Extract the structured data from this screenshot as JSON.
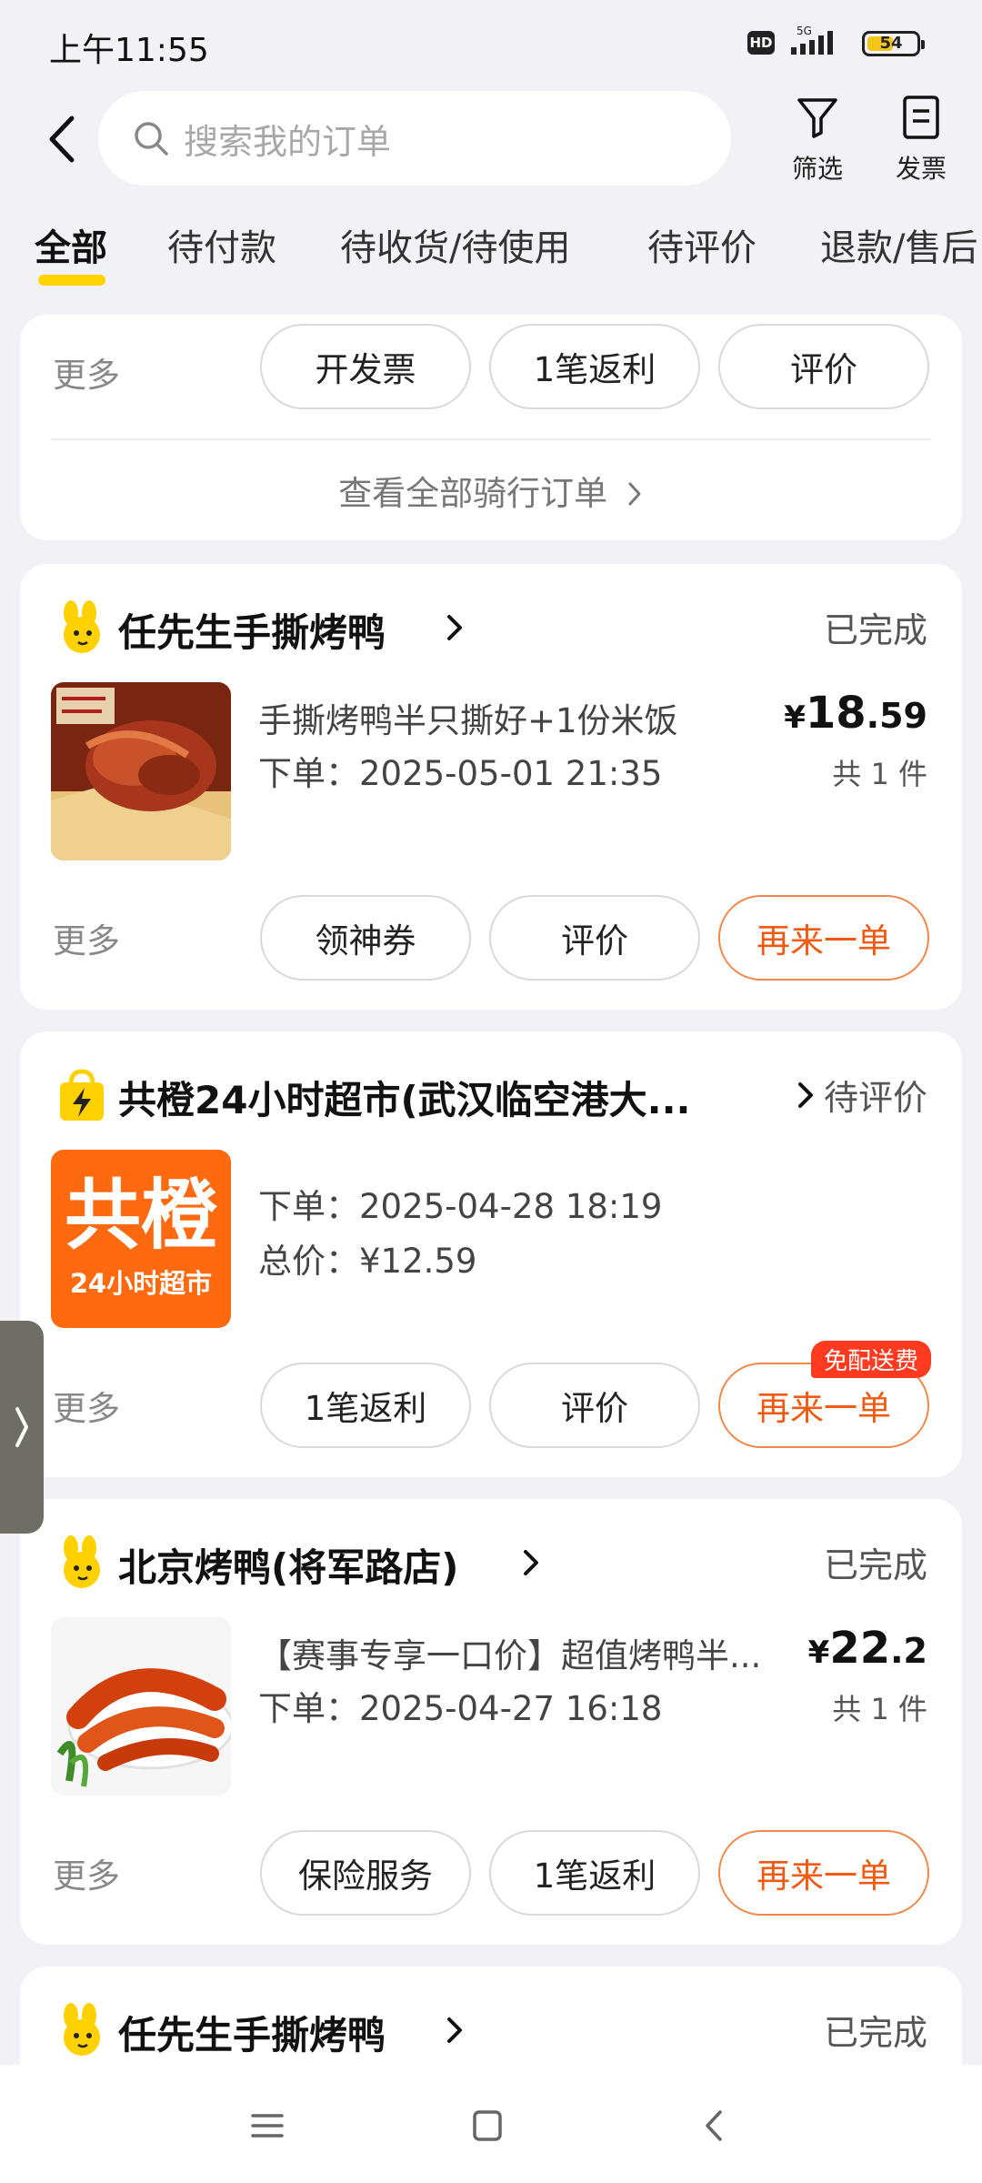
{
  "status_bar": {
    "time": "上午11:55",
    "hd": "HD",
    "network": "5G",
    "battery": "54",
    "battery_level": 0.54
  },
  "header": {
    "search_placeholder": "搜索我的订单",
    "filter_label": "筛选",
    "invoice_label": "发票"
  },
  "tabs": [
    "全部",
    "待付款",
    "待收货/待使用",
    "待评价",
    "退款/售后"
  ],
  "partial_card": {
    "more": "更多",
    "buttons": [
      "开发票",
      "1笔返利",
      "评价"
    ],
    "view_all": "查看全部骑行订单"
  },
  "orders": [
    {
      "store": "任先生手撕烤鸭",
      "status": "已完成",
      "item": "手撕烤鸭半只撕好+1份米饭",
      "date": "下单：2025-05-01 21:35",
      "price_currency": "¥",
      "price_int": "18",
      "price_dec": ".59",
      "qty": "共 1 件",
      "more": "更多",
      "buttons": [
        "领神券",
        "评价",
        "再来一单"
      ]
    },
    {
      "store": "共橙24小时超市(武汉临空港大...",
      "status": "待评价",
      "date": "下单：2025-04-28 18:19",
      "total": "总价：¥12.59",
      "logo_top": "共橙",
      "logo_bottom": "24小时超市",
      "more": "更多",
      "buttons": [
        "1笔返利",
        "评价",
        "再来一单"
      ],
      "badge": "免配送费"
    },
    {
      "store": "北京烤鸭(将军路店)",
      "status": "已完成",
      "item": "【赛事专享一口价】超值烤鸭半...",
      "date": "下单：2025-04-27 16:18",
      "price_currency": "¥",
      "price_int": "22",
      "price_dec": ".2",
      "qty": "共 1 件",
      "more": "更多",
      "buttons": [
        "保险服务",
        "1笔返利",
        "再来一单"
      ]
    },
    {
      "store": "任先生手撕烤鸭",
      "status": "已完成"
    }
  ],
  "colors": {
    "accent": "#ffd400",
    "primary_button": "#f05a12",
    "badge": "#ff3a1f",
    "gongcheng": "#ff6a10"
  }
}
